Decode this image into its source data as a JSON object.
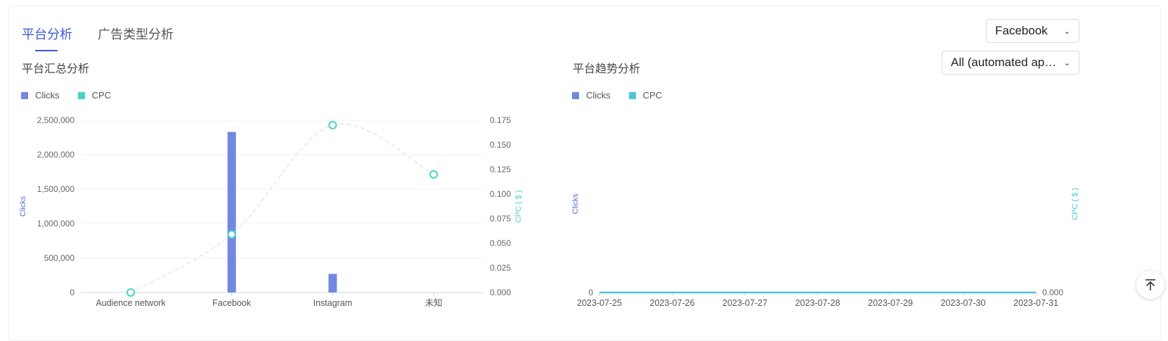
{
  "tabs": [
    {
      "label": "平台分析",
      "active": true
    },
    {
      "label": "广告类型分析",
      "active": false
    }
  ],
  "platform_select": {
    "value": "Facebook"
  },
  "app_select": {
    "value": "All (automated app ..."
  },
  "left_section": {
    "title": "平台汇总分析"
  },
  "right_section": {
    "title": "平台趋势分析"
  },
  "colors": {
    "clicks": "#7088e0",
    "cpc": "#48d3c4",
    "cpc_right": "#4cc6dd",
    "accent": "#3a58d3"
  },
  "chart_data": [
    {
      "type": "bar",
      "title": "平台汇总分析",
      "legend": [
        "Clicks",
        "CPC"
      ],
      "legend_position": "top-left",
      "categories": [
        "Audience network",
        "Facebook",
        "Instagram",
        "未知"
      ],
      "series": [
        {
          "name": "Clicks",
          "type": "bar",
          "axis": "left",
          "values": [
            0,
            2330000,
            270000,
            0
          ]
        },
        {
          "name": "CPC",
          "type": "line",
          "axis": "right",
          "values": [
            0.0,
            0.059,
            0.17,
            0.12
          ]
        }
      ],
      "ylabel": "Clicks",
      "ylabel_right": "CPC ( $ )",
      "ylim": [
        0,
        2500000
      ],
      "ylim_right": [
        0,
        0.175
      ],
      "yticks": [
        "0",
        "500,000",
        "1,000,000",
        "1,500,000",
        "2,000,000",
        "2,500,000"
      ],
      "yticks_right": [
        "0.000",
        "0.025",
        "0.050",
        "0.075",
        "0.100",
        "0.125",
        "0.150",
        "0.175"
      ],
      "grid": true
    },
    {
      "type": "line",
      "title": "平台趋势分析",
      "legend": [
        "Clicks",
        "CPC"
      ],
      "legend_position": "top-left",
      "categories": [
        "2023-07-25",
        "2023-07-26",
        "2023-07-27",
        "2023-07-28",
        "2023-07-29",
        "2023-07-30",
        "2023-07-31"
      ],
      "series": [
        {
          "name": "Clicks",
          "axis": "left",
          "values": [
            0,
            0,
            0,
            0,
            0,
            0,
            0
          ]
        },
        {
          "name": "CPC",
          "axis": "right",
          "values": [
            0,
            0,
            0,
            0,
            0,
            0,
            0
          ]
        }
      ],
      "ylabel": "Clicks",
      "ylabel_right": "CPC ( $ )",
      "yticks": [
        "0"
      ],
      "yticks_right": [
        "0.000"
      ]
    }
  ]
}
